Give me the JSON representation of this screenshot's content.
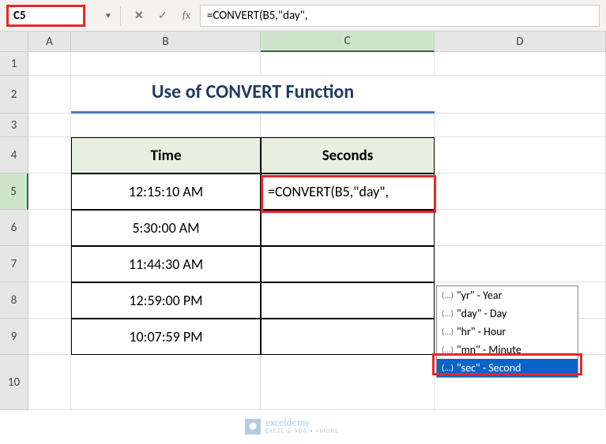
{
  "name_box": "C5",
  "formula_text": "=CONVERT(B5,\"day\",",
  "columns": [
    "A",
    "B",
    "C",
    "D"
  ],
  "rows": [
    "1",
    "2",
    "3",
    "4",
    "5",
    "6",
    "7",
    "8",
    "9",
    "10"
  ],
  "title": "Use of CONVERT Function",
  "table": {
    "headers": {
      "time": "Time",
      "seconds": "Seconds"
    },
    "data": [
      {
        "time": "12:15:10 AM",
        "c5_formula": "=CONVERT(B5,\"day\","
      },
      {
        "time": "5:30:00 AM"
      },
      {
        "time": "11:44:30 AM"
      },
      {
        "time": "12:59:00 PM"
      },
      {
        "time": "10:07:59 PM"
      }
    ]
  },
  "autocomplete": {
    "items": [
      {
        "label": "\"yr\" - Year"
      },
      {
        "label": "\"day\" - Day"
      },
      {
        "label": "\"hr\" - Hour"
      },
      {
        "label": "\"mn\" - Minute"
      },
      {
        "label": "\"sec\" - Second"
      }
    ],
    "icon": "(...)"
  },
  "watermark": {
    "brand": "exceldemy",
    "sub": "EXCEL & VBA • +MORE"
  },
  "icons": {
    "cancel": "✕",
    "check": "✓",
    "fx": "fx",
    "dropdown": "▼"
  }
}
